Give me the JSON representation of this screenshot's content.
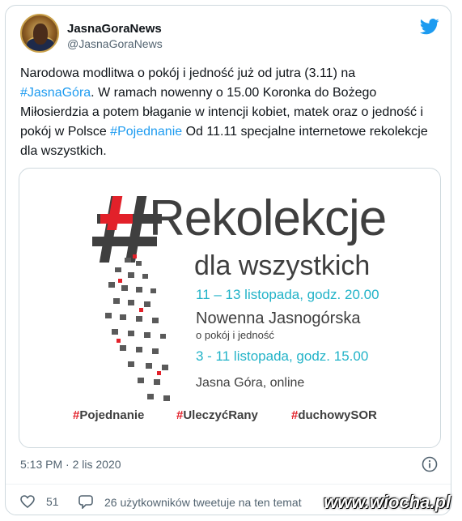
{
  "author": {
    "name": "JasnaGoraNews",
    "handle": "@JasnaGoraNews",
    "avatar_icon": "avatar-icon"
  },
  "platform_icon": "twitter-bird-icon",
  "tweet": {
    "text_parts": [
      "Narodowa modlitwa o pokój i jedność już od jutra (3.11) na",
      "#JasnaGóra",
      ". W ramach nowenny o 15.00 Koronka do Bożego Miłosierdzia a potem błaganie w intencji kobiet, matek oraz o jedność i pokój w Polsce ",
      "#Pojednanie",
      " Od 11.11 specjalne internetowe rekolekcje dla wszystkich."
    ]
  },
  "media": {
    "hash": "#",
    "title": "Rekolekcje",
    "subtitle": "dla wszystkich",
    "date1": "11 – 13 listopada, godz. 20.00",
    "novena_title": "Nowenna Jasnogórska",
    "novena_sub": "o pokój i jedność",
    "date2": "3 - 11 listopada, godz. 15.00",
    "place": "Jasna Góra, online",
    "hashtags": [
      "Pojednanie",
      "UleczyćRany",
      "duchowySOR"
    ],
    "accent_color": "#22b3c8",
    "hash_color": "#e2212a"
  },
  "meta": {
    "time": "5:13 PM · 2 lis 2020",
    "info_icon": "info-icon"
  },
  "actions": {
    "likes": "51",
    "retweet_text": "26 użytkowników tweetuje na ten temat"
  },
  "watermark": "www.wiocha.pl",
  "colors": {
    "link": "#1d9bf0",
    "muted": "#536471",
    "border": "#cfd9de"
  }
}
